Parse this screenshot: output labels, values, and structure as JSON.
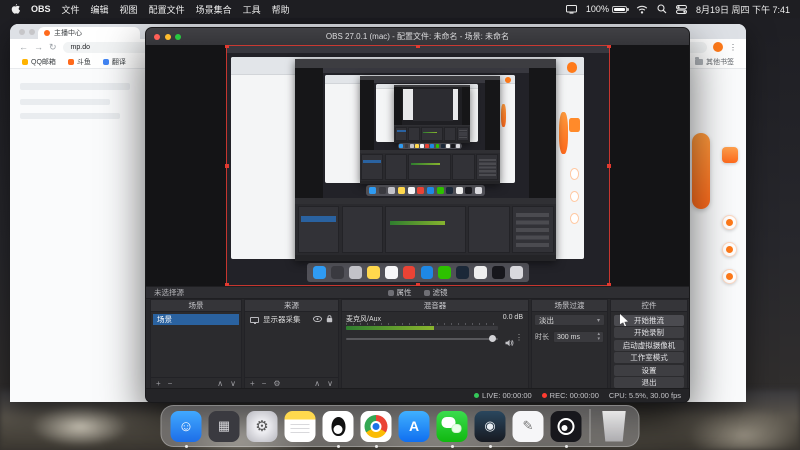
{
  "menu_bar": {
    "app_name": "OBS",
    "menus": [
      "文件",
      "编辑",
      "视图",
      "配置文件",
      "场景集合",
      "工具",
      "帮助"
    ],
    "battery_percent": "100%",
    "datetime": "8月19日 周四 下午 7:41"
  },
  "browser": {
    "tab_title": "主播中心",
    "url": "mp.do",
    "bookmarks": [
      "QQ邮箱",
      "斗鱼",
      "翻译"
    ],
    "bookmarks_right": "其他书签"
  },
  "obs": {
    "window_title": "OBS 27.0.1 (mac) - 配置文件: 未命名 - 场景: 未命名",
    "source_toolbar": {
      "no_source": "未选择源",
      "properties": "属性",
      "filters": "滤镜"
    },
    "scenes": {
      "title": "场景",
      "items": [
        "场景"
      ]
    },
    "sources": {
      "title": "来源",
      "items": [
        "显示器采集"
      ]
    },
    "mixer": {
      "title": "混音器",
      "channel": "麦克风/Aux",
      "level": "0.0 dB"
    },
    "transitions": {
      "title": "场景过渡",
      "current": "淡出",
      "duration_label": "时长",
      "duration_value": "300 ms"
    },
    "controls": {
      "title": "控件",
      "buttons": [
        "开始推流",
        "开始录制",
        "启动虚拟摄像机",
        "工作室模式",
        "设置",
        "退出"
      ]
    },
    "status": {
      "live": "LIVE: 00:00:00",
      "rec": "REC: 00:00:00",
      "cpu": "CPU: 5.5%, 30.00 fps"
    }
  },
  "colors": {
    "accent_orange": "#ff6a1c",
    "selection_blue": "#2a62a0",
    "live_green": "#34c759",
    "rec_red": "#ff3b30"
  },
  "dock": {
    "apps": [
      "finder",
      "launchpad",
      "system-settings",
      "notes",
      "qq",
      "chrome",
      "app-store",
      "wechat",
      "steam",
      "pencil-app",
      "obs",
      "trash"
    ]
  }
}
